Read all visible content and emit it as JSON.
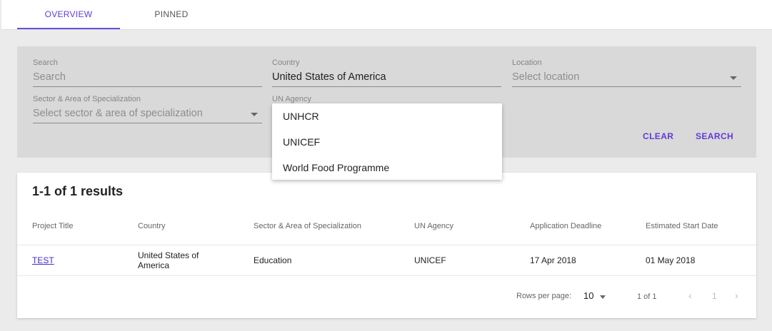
{
  "tabs": [
    {
      "label": "OVERVIEW"
    },
    {
      "label": "PINNED"
    }
  ],
  "filters": {
    "search": {
      "label": "Search",
      "placeholder": "Search"
    },
    "country": {
      "label": "Country",
      "value": "United States of America"
    },
    "location": {
      "label": "Location",
      "placeholder": "Select location"
    },
    "sector": {
      "label": "Sector & Area of Specialization",
      "placeholder": "Select sector & area of specialization"
    },
    "un_agency": {
      "label": "UN Agency"
    },
    "clear_label": "CLEAR",
    "search_label": "SEARCH"
  },
  "dropdown": {
    "options": [
      "UNHCR",
      "UNICEF",
      "World Food Programme"
    ]
  },
  "results": {
    "summary": "1-1 of 1 results",
    "columns": [
      "Project Title",
      "Country",
      "Sector & Area of Specialization",
      "UN Agency",
      "Application Deadline",
      "Estimated Start Date"
    ],
    "rows": [
      {
        "title": "TEST",
        "country_line1": "United States of",
        "country_line2": "America",
        "sector": "Education",
        "agency": "UNICEF",
        "deadline": "17 Apr 2018",
        "start": "01 May 2018"
      }
    ]
  },
  "pagination": {
    "rows_per_page_label": "Rows per page:",
    "rows_per_page": "10",
    "page_info": "1 of 1",
    "current_page": "1"
  },
  "colors": {
    "accent": "#5f3bd7",
    "filter_bg": "#d9d9d9",
    "page_bg": "#ebebeb"
  }
}
